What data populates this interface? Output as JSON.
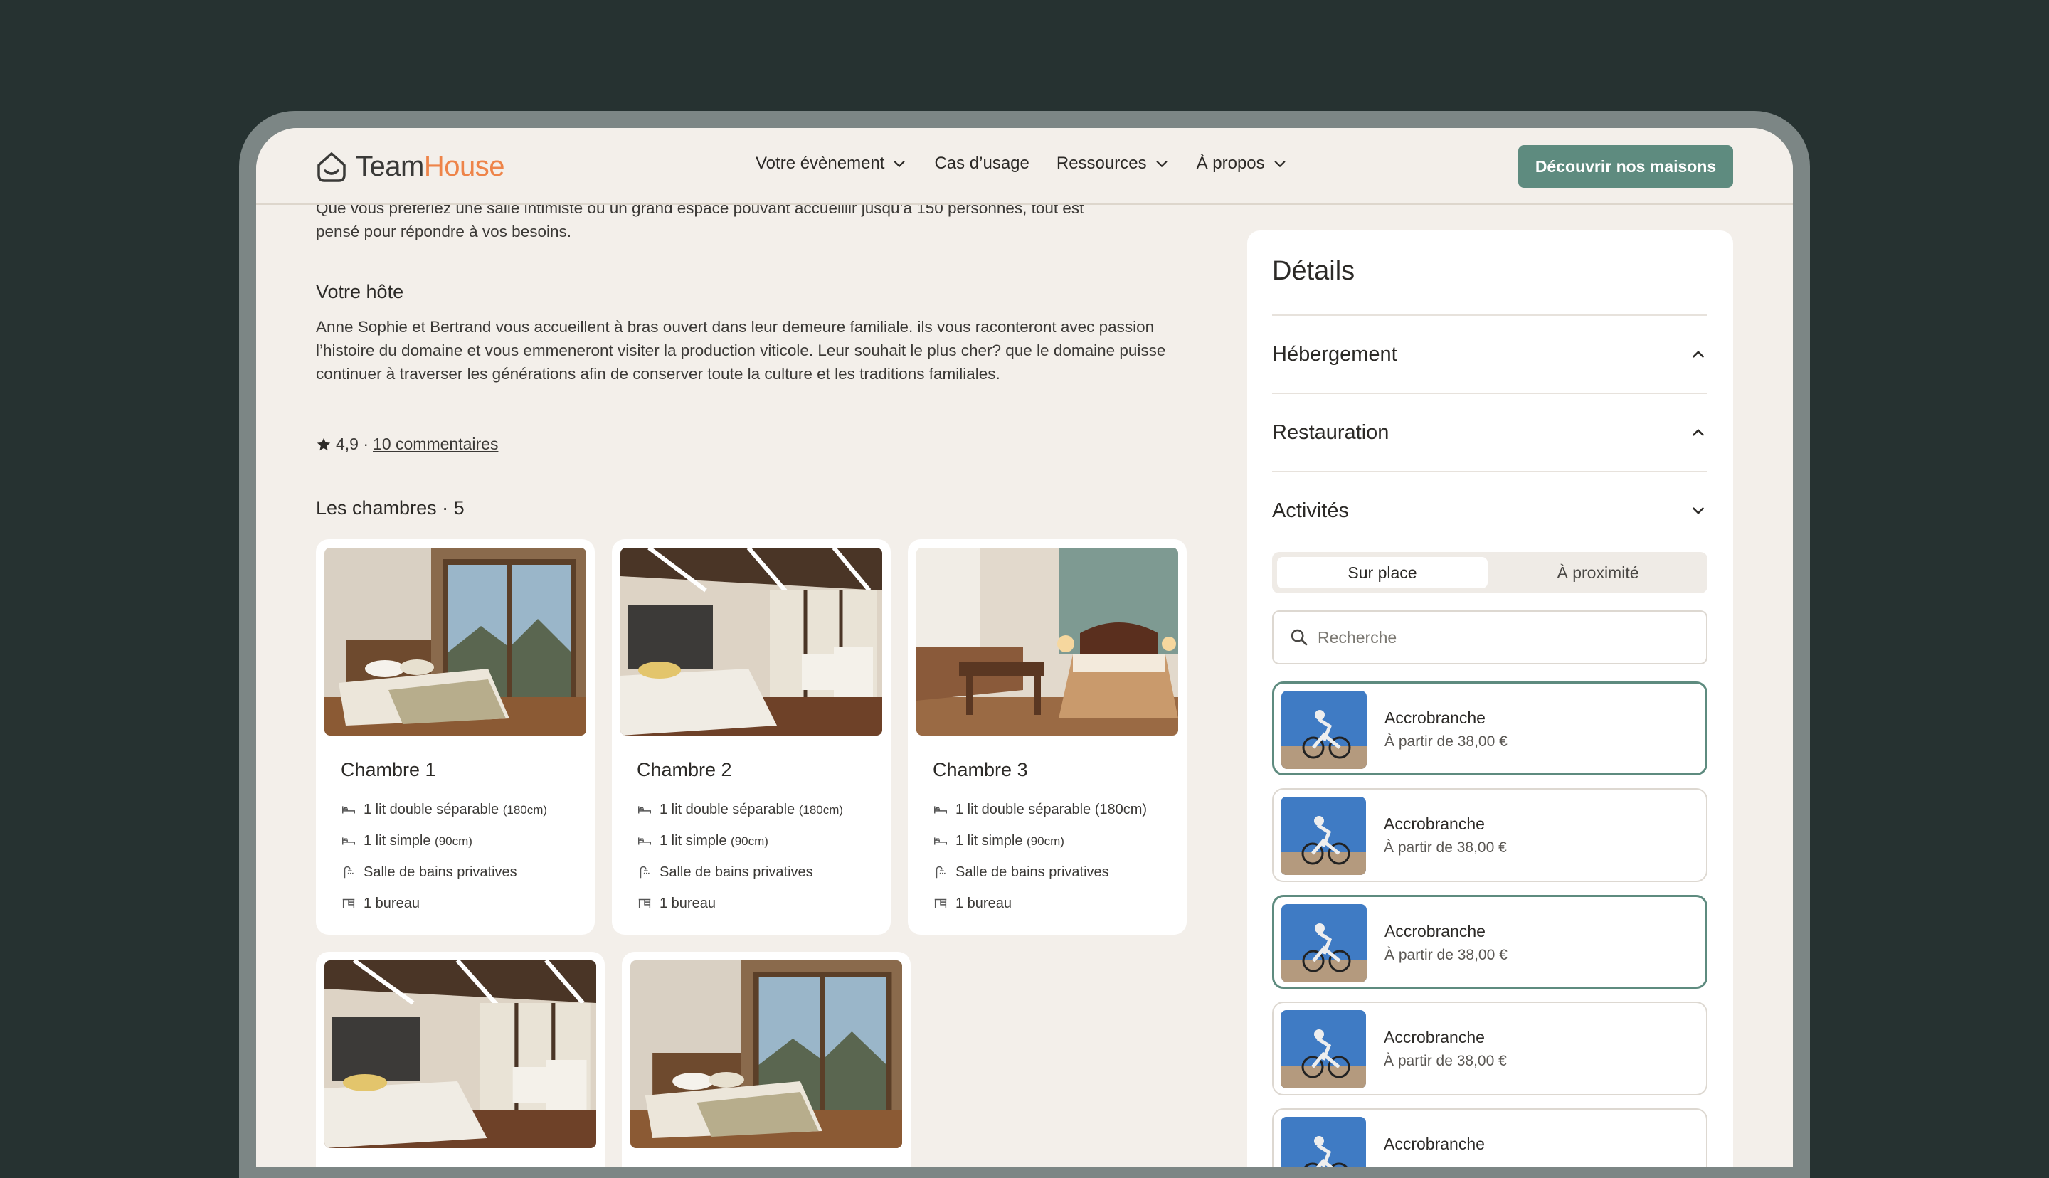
{
  "brand": {
    "name_part1": "Team",
    "name_part2": "House",
    "accent_color": "#ee8449"
  },
  "nav": {
    "items": [
      {
        "label": "Votre évènement",
        "has_dropdown": true
      },
      {
        "label": "Cas d’usage",
        "has_dropdown": false
      },
      {
        "label": "Ressources",
        "has_dropdown": true
      },
      {
        "label": "À propos",
        "has_dropdown": true
      }
    ],
    "cta_label": "Découvrir nos maisons",
    "cta_color": "#5e8b7f"
  },
  "content": {
    "intro_line1": "Que vous préfériez une salle intimiste ou un grand espace pouvant accueillir jusqu’à 150 personnes, tout est",
    "intro_line2": "pensé pour répondre à vos besoins.",
    "host_title": "Votre hôte",
    "host_text": "Anne Sophie et Bertrand vous accueillent à bras ouvert dans leur demeure familiale. ils vous raconteront avec passion l’histoire du domaine et vous emmeneront visiter la production viticole. Leur  souhait le plus cher? que le domaine puisse continuer à traverser les générations afin de conserver toute la culture et les traditions familiales.",
    "rating_value": "4,9 ·",
    "rating_link": "10 commentaires",
    "rooms_title": "Les chambres · 5"
  },
  "rooms": [
    {
      "name": "Chambre 1",
      "bed_double": "1 lit double séparable",
      "bed_double_size": "(180cm)",
      "bed_single": "1 lit simple",
      "bed_single_size": "(90cm)",
      "bath": "Salle de bains privatives",
      "desk": "1 bureau"
    },
    {
      "name": "Chambre 2",
      "bed_double": "1 lit double séparable",
      "bed_double_size": "(180cm)",
      "bed_single": "1 lit simple",
      "bed_single_size": "(90cm)",
      "bath": "Salle de bains privatives",
      "desk": "1 bureau"
    },
    {
      "name": "Chambre 3",
      "bed_double": "1 lit double séparable (180cm)",
      "bed_double_size": "",
      "bed_single": "1 lit simple",
      "bed_single_size": "(90cm)",
      "bath": "Salle de bains privatives",
      "desk": "1 bureau"
    }
  ],
  "sidebar": {
    "title": "Détails",
    "sections": [
      {
        "label": "Hébergement",
        "expanded": false
      },
      {
        "label": "Restauration",
        "expanded": false
      },
      {
        "label": "Activités",
        "expanded": true
      }
    ],
    "segment": {
      "active": "Sur place",
      "inactive": "À proximité"
    },
    "search_placeholder": "Recherche",
    "activities": [
      {
        "name": "Accrobranche",
        "price": "À partir de 38,00 €",
        "selected": true
      },
      {
        "name": "Accrobranche",
        "price": "À partir de 38,00 €",
        "selected": false
      },
      {
        "name": "Accrobranche",
        "price": "À partir de 38,00 €",
        "selected": true
      },
      {
        "name": "Accrobranche",
        "price": "À partir de 38,00 €",
        "selected": false
      },
      {
        "name": "Accrobranche",
        "price": "",
        "selected": false
      }
    ]
  }
}
